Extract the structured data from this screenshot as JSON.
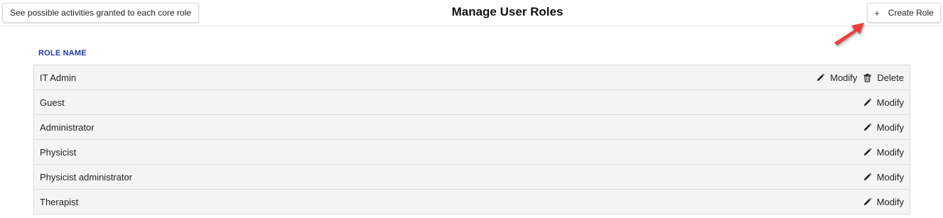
{
  "header": {
    "activities_button": "See possible activities granted to each core role",
    "title": "Manage User Roles",
    "create_button": {
      "icon_glyph": "+",
      "label": "Create Role"
    }
  },
  "table": {
    "column_header": "ROLE NAME",
    "rows": [
      {
        "name": "IT Admin",
        "modify": "Modify",
        "delete": "Delete"
      },
      {
        "name": "Guest",
        "modify": "Modify"
      },
      {
        "name": "Administrator",
        "modify": "Modify"
      },
      {
        "name": "Physicist",
        "modify": "Modify"
      },
      {
        "name": "Physicist administrator",
        "modify": "Modify"
      },
      {
        "name": "Therapist",
        "modify": "Modify"
      }
    ]
  },
  "colors": {
    "column_header": "#1e37a8",
    "row_background": "#f4f4f5",
    "annotation_arrow": "#e8403a"
  },
  "icons": {
    "modify": "pencil-icon",
    "delete": "trash-icon",
    "create": "plus-icon",
    "annotation": "red-arrow-icon"
  }
}
